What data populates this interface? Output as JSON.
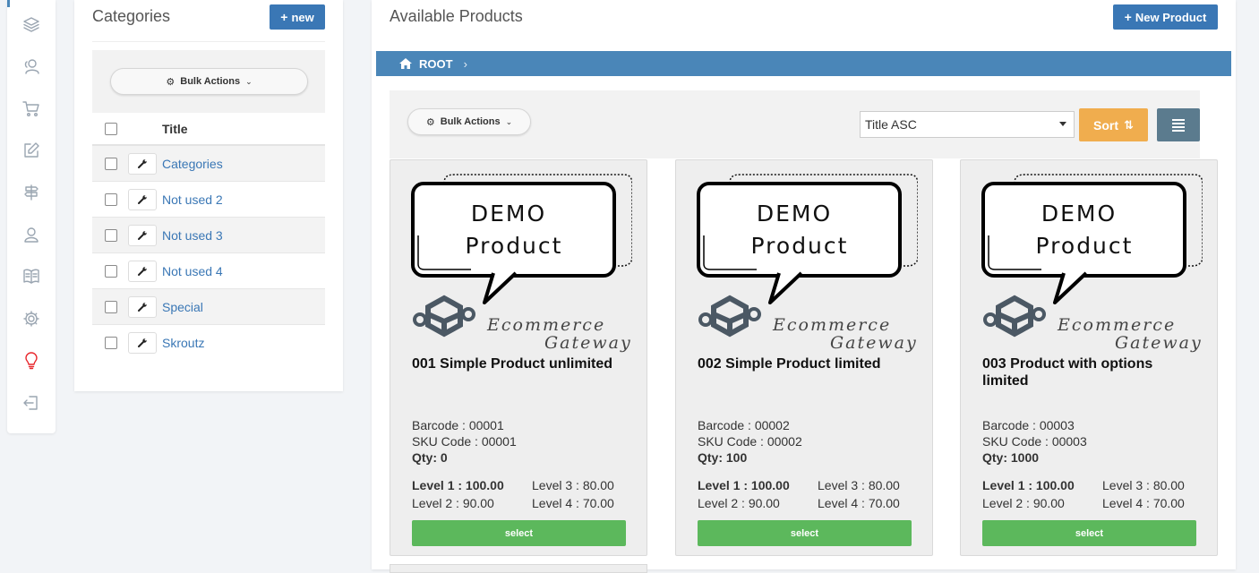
{
  "rail": {
    "items": [
      {
        "icon": "layers-icon"
      },
      {
        "icon": "users-icon"
      },
      {
        "icon": "cart-icon"
      },
      {
        "icon": "edit-icon"
      },
      {
        "icon": "signpost-icon"
      },
      {
        "icon": "user-icon"
      },
      {
        "icon": "book-icon"
      },
      {
        "icon": "gear-icon"
      },
      {
        "icon": "lightbulb-icon",
        "active": true
      },
      {
        "icon": "logout-icon"
      }
    ],
    "active_color": "#e8262b"
  },
  "categories": {
    "title": "Categories",
    "new_label": "new",
    "bulk_label": "Bulk Actions",
    "column_title": "Title",
    "items": [
      {
        "label": "Categories"
      },
      {
        "label": "Not used 2"
      },
      {
        "label": "Not used 3"
      },
      {
        "label": "Not used 4"
      },
      {
        "label": "Special"
      },
      {
        "label": "Skroutz"
      }
    ]
  },
  "products": {
    "title": "Available Products",
    "new_label": "New Product",
    "breadcrumb_root": "ROOT",
    "breadcrumb_sep": "›",
    "bulk_label": "Bulk Actions",
    "sort_value": "Title ASC",
    "sort_label": "Sort",
    "image_text": {
      "line1": "DEMO",
      "line2": "Product",
      "brand1": "Ecommerce",
      "brand2": "Gateway"
    },
    "level_keys": {
      "l1": "Level 1 : ",
      "l2": "Level 2 : ",
      "l3": "Level 3 : ",
      "l4": "Level 4 : "
    },
    "items": [
      {
        "name": "001 Simple Product unlimited",
        "barcode": "Barcode : 00001",
        "sku": "SKU Code : 00001",
        "qty": "Qty: 0",
        "level1": "Level 1 : 100.00",
        "level2": "Level 2 : 90.00",
        "level3": "Level 3 : 80.00",
        "level4": "Level 4 : 70.00",
        "select_label": "select"
      },
      {
        "name": "002 Simple Product limited",
        "barcode": "Barcode : 00002",
        "sku": "SKU Code : 00002",
        "qty": "Qty: 100",
        "level1": "Level 1 : 100.00",
        "level2": "Level 2 : 90.00",
        "level3": "Level 3 : 80.00",
        "level4": "Level 4 : 70.00",
        "select_label": "select"
      },
      {
        "name": "003 Product with options limited",
        "barcode": "Barcode : 00003",
        "sku": "SKU Code : 00003",
        "qty": "Qty: 1000",
        "level1": "Level 1 : 100.00",
        "level2": "Level 2 : 90.00",
        "level3": "Level 3 : 80.00",
        "level4": "Level 4 : 70.00",
        "select_label": "select"
      }
    ]
  },
  "colors": {
    "primary": "#3a77b5",
    "breadcrumb": "#4a86b8",
    "sort": "#f0ad4e",
    "list_view": "#5b7b8e",
    "select": "#5cb85c"
  }
}
